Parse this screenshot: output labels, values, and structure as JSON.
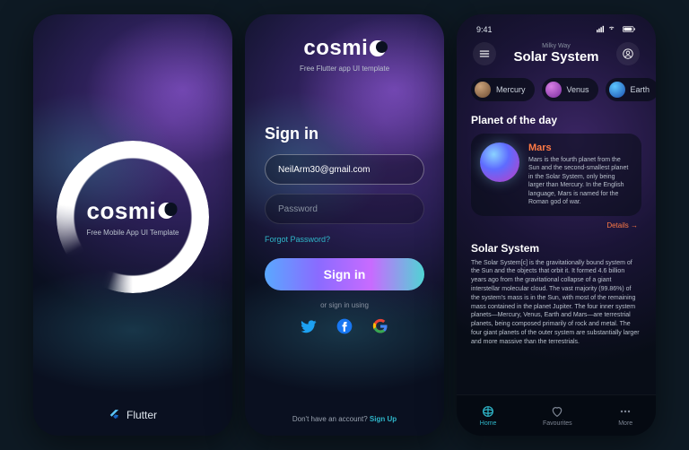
{
  "colors": {
    "accent_cyan": "#2fb6c9",
    "accent_orange": "#ff7a45"
  },
  "splash": {
    "brand": "cosmi",
    "subtitle": "Free Mobile App UI Template",
    "footer_label": "Flutter"
  },
  "signin": {
    "brand": "cosmi",
    "subtitle": "Free Flutter app UI template",
    "heading": "Sign in",
    "email_value": "NeilArm30@gmail.com",
    "password_placeholder": "Password",
    "forgot": "Forgot Password?",
    "button": "Sign in",
    "or_label": "or sign in using",
    "no_account": "Don't have an account?",
    "signup": "Sign Up",
    "socials": [
      "twitter",
      "facebook",
      "google"
    ]
  },
  "home": {
    "status_time": "9:41",
    "breadcrumb": "Milky Way",
    "title": "Solar System",
    "chips": [
      {
        "name": "Mercury",
        "cls": "mercury"
      },
      {
        "name": "Venus",
        "cls": "venus"
      },
      {
        "name": "Earth",
        "cls": "earth"
      }
    ],
    "potd_heading": "Planet of the day",
    "potd_name": "Mars",
    "potd_desc": "Mars is the fourth planet from the Sun and the second-smallest planet in the Solar System, only being larger than Mercury. In the English language, Mars is named for the Roman god of war.",
    "details_label": "Details",
    "about_heading": "Solar System",
    "about_text": "The Solar System[c] is the gravitationally bound system of the Sun and the objects that orbit it. It formed 4.6 billion years ago from the gravitational collapse of a giant interstellar molecular cloud. The vast majority (99.86%) of the system's mass is in the Sun, with most of the remaining mass contained in the planet Jupiter. The four inner system planets—Mercury, Venus, Earth and Mars—are terrestrial planets, being composed primarily of rock and metal. The four giant planets of the outer system are substantially larger and more massive than the terrestrials.",
    "nav": [
      {
        "label": "Home",
        "active": true
      },
      {
        "label": "Favourites",
        "active": false
      },
      {
        "label": "More",
        "active": false
      }
    ]
  }
}
